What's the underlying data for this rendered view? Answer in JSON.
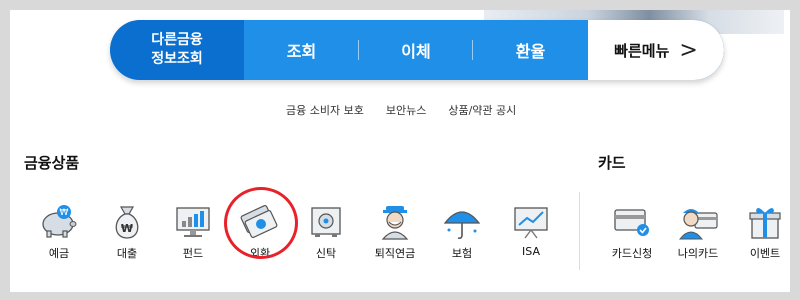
{
  "quickbar": {
    "first_label": "다른금융\n정보조회",
    "items": [
      {
        "label": "조회"
      },
      {
        "label": "이체"
      },
      {
        "label": "환율"
      }
    ],
    "quick_menu_label": "빠른메뉴",
    "chevron": ">"
  },
  "links": [
    "금융 소비자 보호",
    "보안뉴스",
    "상품/약관 공시"
  ],
  "financial": {
    "title": "금융상품",
    "items": [
      {
        "label": "예금",
        "icon": "piggy-bank-icon"
      },
      {
        "label": "대출",
        "icon": "money-bag-icon"
      },
      {
        "label": "펀드",
        "icon": "chart-monitor-icon"
      },
      {
        "label": "외환",
        "icon": "banknotes-icon"
      },
      {
        "label": "신탁",
        "icon": "safe-icon"
      },
      {
        "label": "퇴직연금",
        "icon": "retiree-icon"
      },
      {
        "label": "보험",
        "icon": "umbrella-icon"
      },
      {
        "label": "ISA",
        "icon": "chart-board-icon"
      }
    ]
  },
  "card": {
    "title": "카드",
    "items": [
      {
        "label": "카드신청",
        "icon": "card-apply-icon"
      },
      {
        "label": "나의카드",
        "icon": "my-card-icon"
      },
      {
        "label": "이벤트",
        "icon": "gift-icon"
      }
    ]
  },
  "colors": {
    "primary": "#1f8fe8",
    "primary_dark": "#0b6fd0",
    "highlight_circle": "#e8222a"
  }
}
